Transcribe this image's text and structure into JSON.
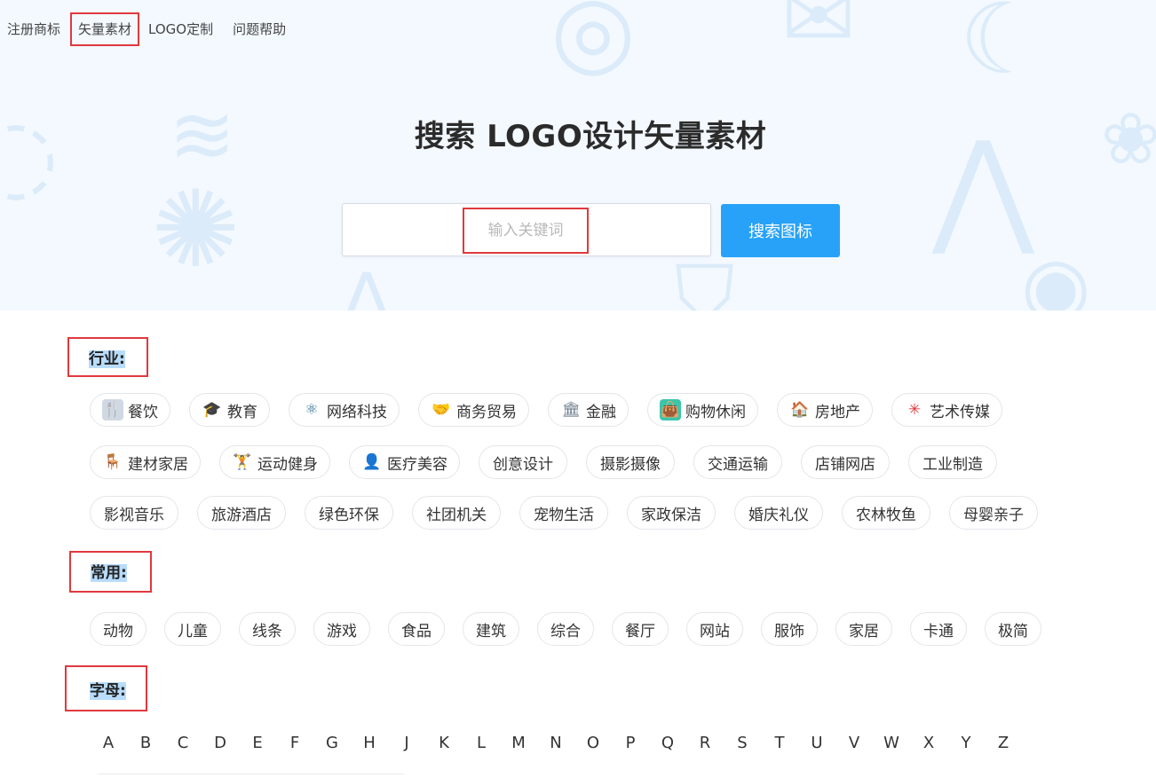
{
  "nav": {
    "items": [
      {
        "label": "注册商标",
        "active": false
      },
      {
        "label": "矢量素材",
        "active": true
      },
      {
        "label": "LOGO定制",
        "active": false
      },
      {
        "label": "问题帮助",
        "active": false
      }
    ]
  },
  "hero": {
    "title": "搜索 LOGO设计矢量素材",
    "search_placeholder": "输入关键词",
    "search_button": "搜索图标"
  },
  "sections": {
    "industry_label": "行业:",
    "common_label": "常用:",
    "letters_label": "字母:"
  },
  "industry_rows": [
    [
      {
        "label": "餐饮",
        "icon": "fork-knife-icon"
      },
      {
        "label": "教育",
        "icon": "graduation-cap-icon"
      },
      {
        "label": "网络科技",
        "icon": "atom-icon"
      },
      {
        "label": "商务贸易",
        "icon": "handshake-icon"
      },
      {
        "label": "金融",
        "icon": "bank-icon"
      },
      {
        "label": "购物休闲",
        "icon": "shopping-bag-icon"
      },
      {
        "label": "房地产",
        "icon": "house-icon"
      },
      {
        "label": "艺术传媒",
        "icon": "starburst-icon"
      }
    ],
    [
      {
        "label": "建材家居",
        "icon": "armchair-icon"
      },
      {
        "label": "运动健身",
        "icon": "dumbbell-icon"
      },
      {
        "label": "医疗美容",
        "icon": "doctor-icon"
      },
      {
        "label": "创意设计",
        "icon": ""
      },
      {
        "label": "摄影摄像",
        "icon": ""
      },
      {
        "label": "交通运输",
        "icon": ""
      },
      {
        "label": "店铺网店",
        "icon": ""
      },
      {
        "label": "工业制造",
        "icon": ""
      }
    ],
    [
      {
        "label": "影视音乐",
        "icon": ""
      },
      {
        "label": "旅游酒店",
        "icon": ""
      },
      {
        "label": "绿色环保",
        "icon": ""
      },
      {
        "label": "社团机关",
        "icon": ""
      },
      {
        "label": "宠物生活",
        "icon": ""
      },
      {
        "label": "家政保洁",
        "icon": ""
      },
      {
        "label": "婚庆礼仪",
        "icon": ""
      },
      {
        "label": "农林牧鱼",
        "icon": ""
      },
      {
        "label": "母婴亲子",
        "icon": ""
      }
    ]
  ],
  "common_tags": [
    "动物",
    "儿童",
    "线条",
    "游戏",
    "食品",
    "建筑",
    "综合",
    "餐厅",
    "网站",
    "服饰",
    "家居",
    "卡通",
    "极简"
  ],
  "letters": [
    "A",
    "B",
    "C",
    "D",
    "E",
    "F",
    "G",
    "H",
    "J",
    "K",
    "L",
    "M",
    "N",
    "O",
    "P",
    "Q",
    "R",
    "S",
    "T",
    "U",
    "V",
    "W",
    "X",
    "Y",
    "Z"
  ],
  "colors": {
    "accent": "#27a2f8",
    "highlight_border": "#e0393e",
    "hero_bg": "#f3f9ff",
    "label_highlight": "#b8dcfb"
  }
}
